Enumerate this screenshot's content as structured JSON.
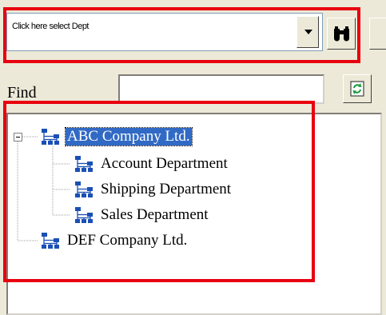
{
  "dept_selector": {
    "value": "Click here select Dept"
  },
  "find": {
    "label": "Find",
    "value": ""
  },
  "tree": {
    "root": {
      "label": "ABC Company Ltd.",
      "children": [
        {
          "label": "Account Department"
        },
        {
          "label": "Shipping Department"
        },
        {
          "label": "Sales Department"
        }
      ]
    },
    "second_root": {
      "label": "DEF Company Ltd."
    }
  },
  "icons": {
    "org_icon": "org-chart-icon",
    "search": "binoculars-icon",
    "refresh": "refresh-icon"
  },
  "colors": {
    "highlight_border": "#e8000f",
    "selection": "#316ac5",
    "window_bg": "#ece9d8",
    "org_icon": "#1a4fb5"
  }
}
